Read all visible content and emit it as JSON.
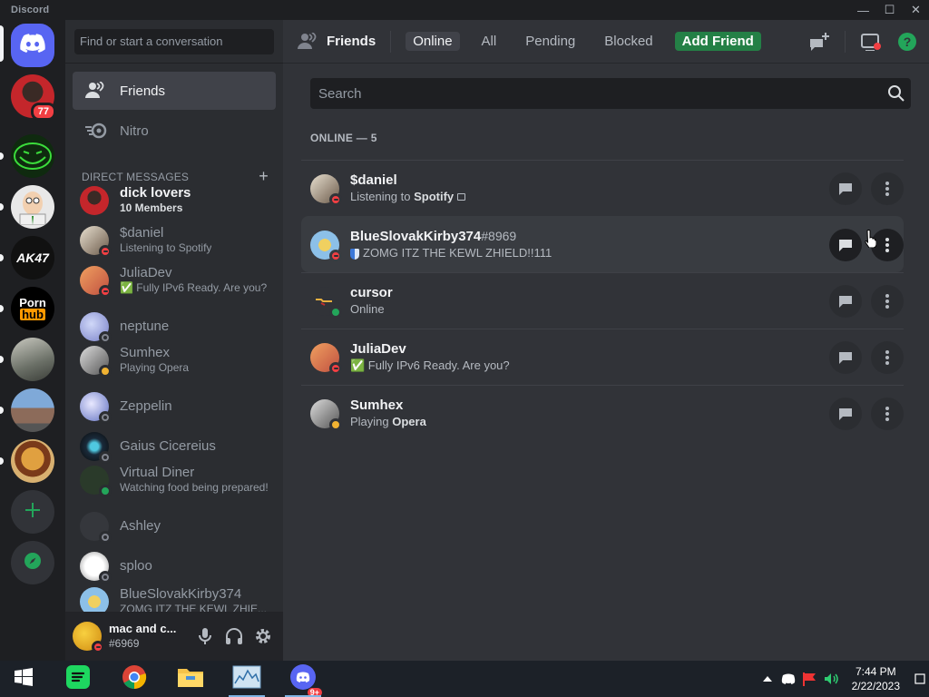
{
  "window": {
    "app_title": "Discord",
    "controls": [
      "—",
      "☐",
      "✕"
    ]
  },
  "rail": {
    "badge_count": "77",
    "avatar_labels": {
      "ak47": "AK47",
      "ph_top": "Porn",
      "ph_bottom": "hub"
    }
  },
  "dm_column": {
    "search_placeholder": "Find or start a conversation",
    "nav": {
      "friends": "Friends",
      "nitro": "Nitro"
    },
    "section_title": "DIRECT MESSAGES",
    "add_symbol": "+",
    "dms": [
      {
        "name": "dick lovers",
        "sub": "10 Members"
      },
      {
        "name": "$daniel",
        "sub": "Listening to Spotify"
      },
      {
        "name": "JuliaDev",
        "sub": "✅ Fully IPv6 Ready. Are you?"
      },
      {
        "name": "neptune",
        "sub": ""
      },
      {
        "name": "Sumhex",
        "sub": "Playing Opera"
      },
      {
        "name": "Zeppelin",
        "sub": ""
      },
      {
        "name": "Gaius Cicereius",
        "sub": ""
      },
      {
        "name": "Virtual Diner",
        "sub": "Watching food being prepared!"
      },
      {
        "name": "Ashley",
        "sub": ""
      },
      {
        "name": "sploo",
        "sub": ""
      },
      {
        "name": "BlueSlovakKirby374",
        "sub": "ZOMG ITZ THE KEWL ZHIE..."
      }
    ]
  },
  "user_panel": {
    "name": "mac and c...",
    "tag": "#6969"
  },
  "topbar": {
    "title": "Friends",
    "tabs": {
      "online": "Online",
      "all": "All",
      "pending": "Pending",
      "blocked": "Blocked",
      "add_friend": "Add Friend"
    }
  },
  "friends": {
    "search_placeholder": "Search",
    "online_header": "ONLINE — 5",
    "rows": [
      {
        "name": "$daniel",
        "disc": "",
        "status_pre": "Listening to ",
        "status_bold": "Spotify"
      },
      {
        "name": "BlueSlovakKirby374",
        "disc": "#8969",
        "status_pre": "ZOMG ITZ THE KEWL ZHIELD!!111",
        "status_bold": ""
      },
      {
        "name": "cursor",
        "disc": "",
        "status_pre": "Online",
        "status_bold": ""
      },
      {
        "name": "JuliaDev",
        "disc": "",
        "status_pre": "✅ Fully IPv6 Ready. Are you?",
        "status_bold": ""
      },
      {
        "name": "Sumhex",
        "disc": "",
        "status_pre": "Playing ",
        "status_bold": "Opera"
      }
    ]
  },
  "taskbar": {
    "discord_badge": "9+",
    "time": "7:44 PM",
    "date": "2/22/2023"
  },
  "colors": {
    "blurple": "#5865f2",
    "green": "#23a55a",
    "dnd_red": "#f23f43",
    "idle_yellow": "#f0b232",
    "add_friend_green": "#248046"
  },
  "icons": [
    "discord-logo-icon",
    "friends-wave-icon",
    "nitro-icon",
    "new-group-dm-icon",
    "inbox-icon",
    "help-icon",
    "search-icon",
    "message-icon",
    "more-vertical-icon",
    "microphone-icon",
    "headphones-icon",
    "gear-icon",
    "add-server-icon",
    "explore-compass-icon",
    "windows-start-icon",
    "chrome-icon",
    "file-explorer-icon"
  ]
}
